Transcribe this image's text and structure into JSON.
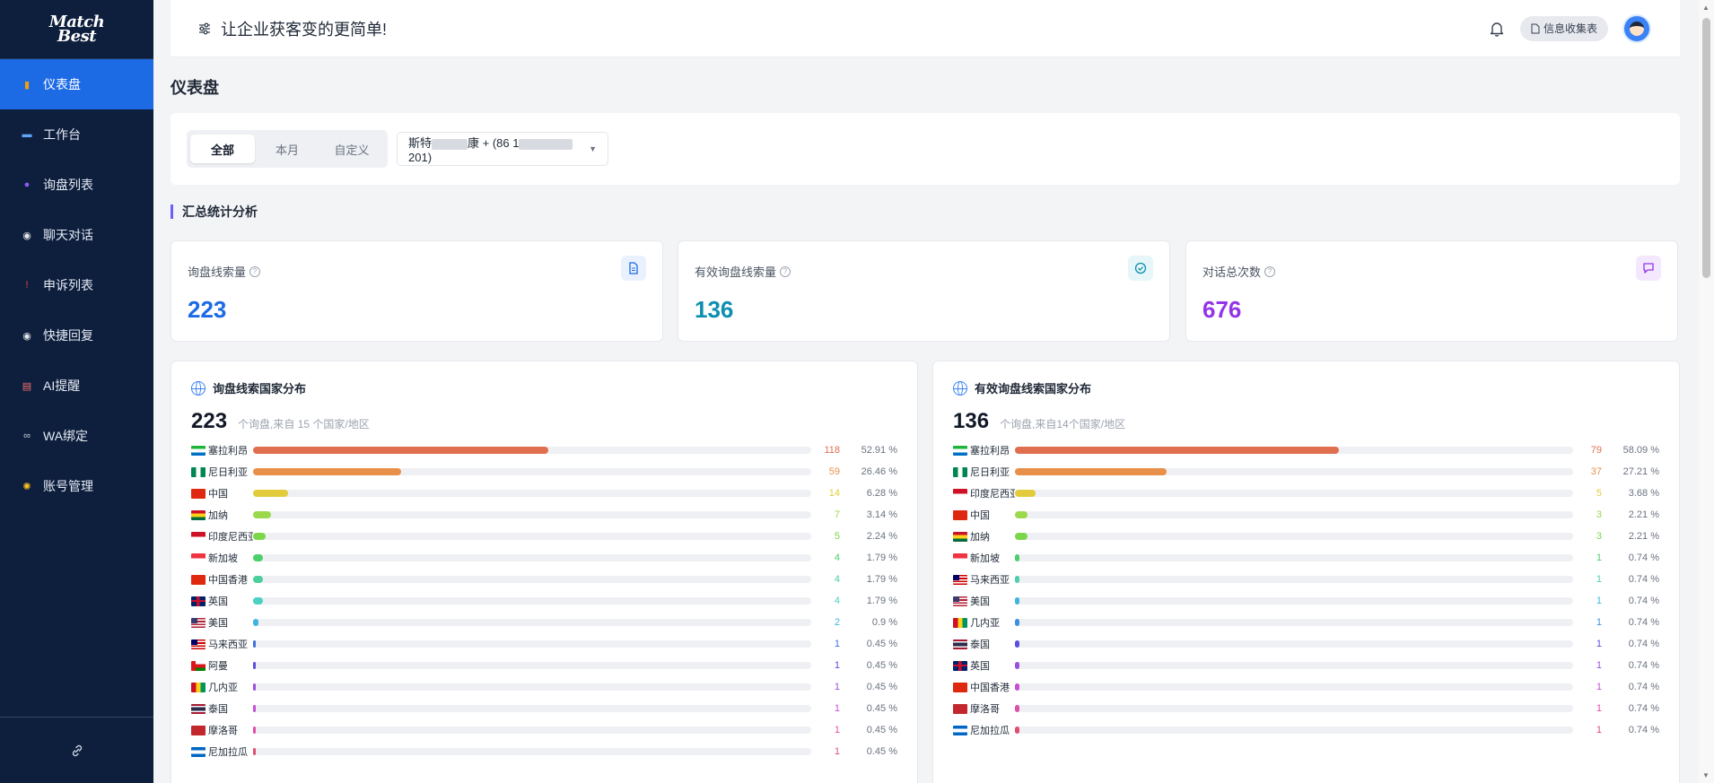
{
  "app": {
    "logo_line1": "Match",
    "logo_line2": "Best",
    "slogan": "让企业获客变的更简单!",
    "form_button": "信息收集表"
  },
  "sidebar": {
    "items": [
      {
        "label": "仪表盘",
        "icon": "dashboard-icon",
        "active": true,
        "color": "#f59e0b"
      },
      {
        "label": "工作台",
        "icon": "laptop-icon",
        "active": false,
        "color": "#60a5fa"
      },
      {
        "label": "询盘列表",
        "icon": "users-icon",
        "active": false,
        "color": "#8b5cf6"
      },
      {
        "label": "聊天对话",
        "icon": "chat-icon",
        "active": false,
        "color": "#e5e7eb"
      },
      {
        "label": "申诉列表",
        "icon": "exclamation-icon",
        "active": false,
        "color": "#ef4444"
      },
      {
        "label": "快捷回复",
        "icon": "reply-icon",
        "active": false,
        "color": "#e5e7eb"
      },
      {
        "label": "AI提醒",
        "icon": "memo-icon",
        "active": false,
        "color": "#f87171"
      },
      {
        "label": "WA绑定",
        "icon": "link-icon",
        "active": false,
        "color": "#cbd5e1"
      },
      {
        "label": "账号管理",
        "icon": "gear-icon",
        "active": false,
        "color": "#fbbf24"
      }
    ]
  },
  "page": {
    "title": "仪表盘",
    "section_title": "汇总统计分析"
  },
  "filter": {
    "segments": [
      "全部",
      "本月",
      "自定义"
    ],
    "active_segment": "全部",
    "account_prefix": "斯特",
    "account_mid": "康 + (86 1",
    "account_suffix": "201)"
  },
  "stats": [
    {
      "label": "询盘线索量",
      "value": "223",
      "color": "#1d6ae5",
      "icon": "document-icon",
      "icon_bg": "#eaf1fe"
    },
    {
      "label": "有效询盘线索量",
      "value": "136",
      "color": "#0e8fb0",
      "icon": "check-circle-icon",
      "icon_bg": "#e6f6f9"
    },
    {
      "label": "对话总次数",
      "value": "676",
      "color": "#9333ea",
      "icon": "message-icon",
      "icon_bg": "#f3e8fe"
    }
  ],
  "dist_left": {
    "title": "询盘线索国家分布",
    "total": "223",
    "subtitle": "个询盘,来自 15 个国家/地区",
    "rows": [
      {
        "name": "塞拉利昂",
        "count": "118",
        "pct": "52.91 %",
        "ratio": 0.5291,
        "color": "#e06f4f",
        "flag": "sierra-leone"
      },
      {
        "name": "尼日利亚",
        "count": "59",
        "pct": "26.46 %",
        "ratio": 0.2646,
        "color": "#e8904a",
        "flag": "nigeria"
      },
      {
        "name": "中国",
        "count": "14",
        "pct": "6.28 %",
        "ratio": 0.0628,
        "color": "#e2cc3c",
        "flag": "china"
      },
      {
        "name": "加纳",
        "count": "7",
        "pct": "3.14 %",
        "ratio": 0.0314,
        "color": "#9bd84c",
        "flag": "ghana"
      },
      {
        "name": "印度尼西亚",
        "count": "5",
        "pct": "2.24 %",
        "ratio": 0.0224,
        "color": "#7cd64a",
        "flag": "indonesia"
      },
      {
        "name": "新加坡",
        "count": "4",
        "pct": "1.79 %",
        "ratio": 0.0179,
        "color": "#4cd06a",
        "flag": "singapore"
      },
      {
        "name": "中国香港",
        "count": "4",
        "pct": "1.79 %",
        "ratio": 0.0179,
        "color": "#4ccf9a",
        "flag": "hongkong"
      },
      {
        "name": "英国",
        "count": "4",
        "pct": "1.79 %",
        "ratio": 0.0179,
        "color": "#4cd0c4",
        "flag": "uk"
      },
      {
        "name": "美国",
        "count": "2",
        "pct": "0.9 %",
        "ratio": 0.009,
        "color": "#3fb4e0",
        "flag": "usa"
      },
      {
        "name": "马来西亚",
        "count": "1",
        "pct": "0.45 %",
        "ratio": 0.0045,
        "color": "#3f6fe0",
        "flag": "malaysia"
      },
      {
        "name": "阿曼",
        "count": "1",
        "pct": "0.45 %",
        "ratio": 0.0045,
        "color": "#5a4fe0",
        "flag": "oman"
      },
      {
        "name": "几内亚",
        "count": "1",
        "pct": "0.45 %",
        "ratio": 0.0045,
        "color": "#9a4fe0",
        "flag": "guinea"
      },
      {
        "name": "泰国",
        "count": "1",
        "pct": "0.45 %",
        "ratio": 0.0045,
        "color": "#c44fd6",
        "flag": "thailand"
      },
      {
        "name": "摩洛哥",
        "count": "1",
        "pct": "0.45 %",
        "ratio": 0.0045,
        "color": "#e04fa8",
        "flag": "morocco"
      },
      {
        "name": "尼加拉瓜",
        "count": "1",
        "pct": "0.45 %",
        "ratio": 0.0045,
        "color": "#e04f6f",
        "flag": "nicaragua"
      }
    ]
  },
  "dist_right": {
    "title": "有效询盘线索国家分布",
    "total": "136",
    "subtitle": "个询盘,来自14个国家/地区",
    "rows": [
      {
        "name": "塞拉利昂",
        "count": "79",
        "pct": "58.09 %",
        "ratio": 0.5809,
        "color": "#e06f4f",
        "flag": "sierra-leone"
      },
      {
        "name": "尼日利亚",
        "count": "37",
        "pct": "27.21 %",
        "ratio": 0.2721,
        "color": "#e8904a",
        "flag": "nigeria"
      },
      {
        "name": "印度尼西亚",
        "count": "5",
        "pct": "3.68 %",
        "ratio": 0.0368,
        "color": "#e2cc3c",
        "flag": "indonesia"
      },
      {
        "name": "中国",
        "count": "3",
        "pct": "2.21 %",
        "ratio": 0.0221,
        "color": "#9bd84c",
        "flag": "china"
      },
      {
        "name": "加纳",
        "count": "3",
        "pct": "2.21 %",
        "ratio": 0.0221,
        "color": "#7cd64a",
        "flag": "ghana"
      },
      {
        "name": "新加坡",
        "count": "1",
        "pct": "0.74 %",
        "ratio": 0.0074,
        "color": "#4cd06a",
        "flag": "singapore"
      },
      {
        "name": "马来西亚",
        "count": "1",
        "pct": "0.74 %",
        "ratio": 0.0074,
        "color": "#4ccfb0",
        "flag": "malaysia"
      },
      {
        "name": "美国",
        "count": "1",
        "pct": "0.74 %",
        "ratio": 0.0074,
        "color": "#3fb4e0",
        "flag": "usa"
      },
      {
        "name": "几内亚",
        "count": "1",
        "pct": "0.74 %",
        "ratio": 0.0074,
        "color": "#3f8fe0",
        "flag": "guinea"
      },
      {
        "name": "泰国",
        "count": "1",
        "pct": "0.74 %",
        "ratio": 0.0074,
        "color": "#5a4fe0",
        "flag": "thailand"
      },
      {
        "name": "英国",
        "count": "1",
        "pct": "0.74 %",
        "ratio": 0.0074,
        "color": "#9a4fe0",
        "flag": "uk"
      },
      {
        "name": "中国香港",
        "count": "1",
        "pct": "0.74 %",
        "ratio": 0.0074,
        "color": "#c44fd6",
        "flag": "hongkong"
      },
      {
        "name": "摩洛哥",
        "count": "1",
        "pct": "0.74 %",
        "ratio": 0.0074,
        "color": "#e04fa8",
        "flag": "morocco"
      },
      {
        "name": "尼加拉瓜",
        "count": "1",
        "pct": "0.74 %",
        "ratio": 0.0074,
        "color": "#e04f6f",
        "flag": "nicaragua"
      }
    ]
  }
}
